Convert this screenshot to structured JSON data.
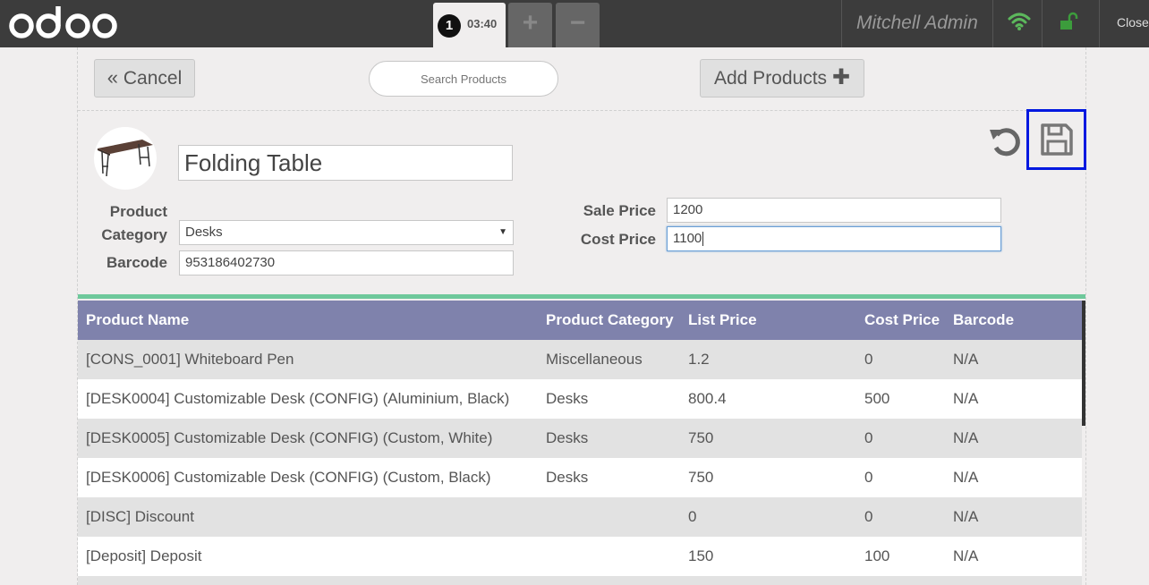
{
  "topbar": {
    "logo_text": "odoo",
    "order": {
      "number": "1",
      "time": "03:40"
    },
    "add_order_label": "+",
    "delete_order_label": "−",
    "user_name": "Mitchell Admin",
    "wifi_icon": "wifi-icon",
    "lock_icon": "unlock-icon",
    "close_label": "Close",
    "colors": {
      "bar": "#3c3c3c",
      "wifi": "#5cb85c",
      "lock": "#3c9c3c"
    }
  },
  "toolbar": {
    "cancel_label": "Cancel",
    "search_placeholder": "Search Products",
    "add_products_label": "Add Products"
  },
  "product_form": {
    "name": "Folding Table",
    "category_label_line1": "Product",
    "category_label_line2": "Category",
    "category_value": "Desks",
    "barcode_label": "Barcode",
    "barcode_value": "953186402730",
    "sale_price_label": "Sale Price",
    "sale_price_value": "1200",
    "cost_price_label": "Cost Price",
    "cost_price_value": "1100"
  },
  "table": {
    "headers": [
      "Product Name",
      "Product Category",
      "List Price",
      "Cost Price",
      "Barcode"
    ],
    "rows": [
      [
        "[CONS_0001] Whiteboard Pen",
        "Miscellaneous",
        "1.2",
        "0",
        "N/A"
      ],
      [
        "[DESK0004] Customizable Desk (CONFIG) (Aluminium, Black)",
        "Desks",
        "800.4",
        "500",
        "N/A"
      ],
      [
        "[DESK0005] Customizable Desk (CONFIG) (Custom, White)",
        "Desks",
        "750",
        "0",
        "N/A"
      ],
      [
        "[DESK0006] Customizable Desk (CONFIG) (Custom, Black)",
        "Desks",
        "750",
        "0",
        "N/A"
      ],
      [
        "[DISC] Discount",
        "",
        "0",
        "0",
        "N/A"
      ],
      [
        "[Deposit] Deposit",
        "",
        "150",
        "100",
        "N/A"
      ]
    ],
    "colors": {
      "header": "#7f82ac",
      "accent": "#6ec89b",
      "highlight": "#0018e0"
    }
  }
}
